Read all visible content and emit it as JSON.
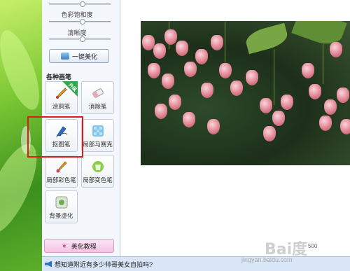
{
  "adjust": {
    "saturation_label": "色彩饱和度",
    "sharpness_label": "清晰度",
    "one_click_label": "一键美化"
  },
  "brushes": {
    "section_title": "各种画笔",
    "upgrade_badge": "升级",
    "items": [
      {
        "label": "涂鸦笔"
      },
      {
        "label": "消除笔"
      },
      {
        "label": "抠图笔"
      },
      {
        "label": "局部马赛克"
      },
      {
        "label": "局部彩色笔"
      },
      {
        "label": "局部变色笔"
      },
      {
        "label": "背景虚化"
      }
    ]
  },
  "tutorial": {
    "label": "美化教程"
  },
  "canvas": {
    "size_readout": "500"
  },
  "status": {
    "message": "想知道附近有多少帅哥美女自拍吗?"
  },
  "watermark": {
    "brand": "Bai度",
    "site": "jingyan.baidu.com"
  },
  "colors": {
    "highlight_box": "#d62020",
    "panel_bg": "#f4f7fb",
    "statusbar_bg": "#d8e6f7"
  }
}
